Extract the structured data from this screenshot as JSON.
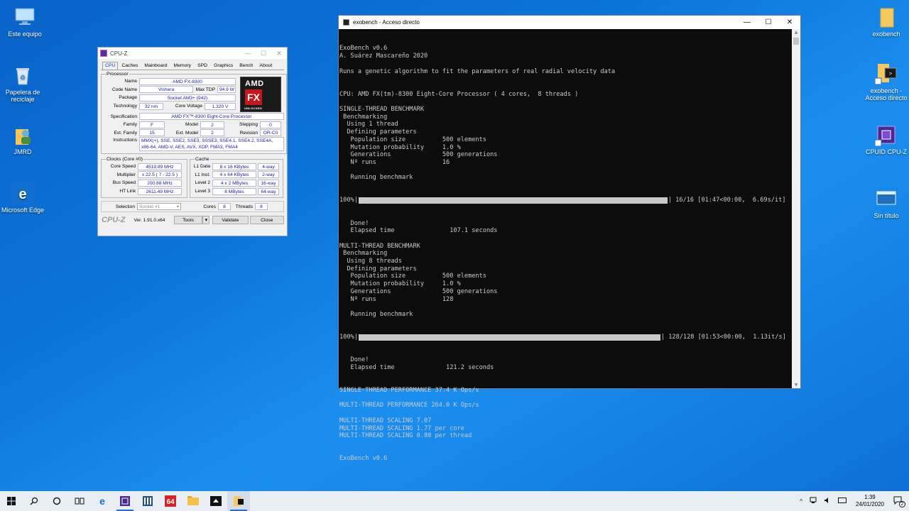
{
  "desktop": {
    "icons_left": [
      {
        "label": "Este equipo",
        "icon": "computer-icon"
      },
      {
        "label": "Papelera de reciclaje",
        "icon": "recycle-bin-icon"
      },
      {
        "label": "JMRD",
        "icon": "user-folder-icon"
      },
      {
        "label": "Microsoft Edge",
        "icon": "edge-icon"
      }
    ],
    "icons_right": [
      {
        "label": "exobench",
        "icon": "folder-icon"
      },
      {
        "label": "exobench - Acceso directo",
        "icon": "shortcut-icon"
      },
      {
        "label": "CPUID CPU-Z",
        "icon": "cpuz-icon"
      },
      {
        "label": "Sin título",
        "icon": "window-icon"
      }
    ]
  },
  "cpuz": {
    "title": "CPU-Z",
    "tabs": [
      "CPU",
      "Caches",
      "Mainboard",
      "Memory",
      "SPD",
      "Graphics",
      "Bench",
      "About"
    ],
    "processor_legend": "Processor",
    "name_label": "Name",
    "name": "AMD FX-8300",
    "codename_label": "Code Name",
    "codename": "Vishera",
    "maxtdp_label": "Max TDP",
    "maxtdp": "94.9 W",
    "package_label": "Package",
    "package": "Socket AM3+ (942)",
    "technology_label": "Technology",
    "technology": "32 nm",
    "corevoltage_label": "Core Voltage",
    "corevoltage": "1.320 V",
    "spec_label": "Specification",
    "spec": "AMD FX™-8300 Eight-Core Processor",
    "family_label": "Family",
    "family": "F",
    "model_label": "Model",
    "model": "2",
    "stepping_label": "Stepping",
    "stepping": "0",
    "extfamily_label": "Ext. Family",
    "extfamily": "15",
    "extmodel_label": "Ext. Model",
    "extmodel": "2",
    "revision_label": "Revision",
    "revision": "OR-C0",
    "instructions_label": "Instructions",
    "instructions_line1": "MMX(+), SSE, SSE2, SSE3, SSSE3, SSE4.1, SSE4.2, SSE4A,",
    "instructions_line2": "x86-64, AMD-V, AES, AVX, XOP, FMA3, FMA4",
    "logo_brand": "AMD",
    "logo_fx": "FX",
    "logo_sub": "UNLOCKED",
    "clocks_legend": "Clocks (Core #0)",
    "corespeed_label": "Core Speed",
    "corespeed": "4519.89 MHz",
    "multiplier_label": "Multiplier",
    "multiplier": "x 22.5 ( 7 - 22.5 )",
    "busspeed_label": "Bus Speed",
    "busspeed": "200.88 MHz",
    "htlink_label": "HT Link",
    "htlink": "2611.49 MHz",
    "cache_legend": "Cache",
    "l1data_label": "L1 Data",
    "l1data": "8 x 16 KBytes",
    "l1data_way": "4-way",
    "l1inst_label": "L1 Inst.",
    "l1inst": "4 x 64 KBytes",
    "l1inst_way": "2-way",
    "level2_label": "Level 2",
    "level2": "4 x 2 MBytes",
    "level2_way": "16-way",
    "level3_label": "Level 3",
    "level3": "8 MBytes",
    "level3_way": "64-way",
    "selection_label": "Selection",
    "selection": "Socket #1",
    "cores_label": "Cores",
    "cores": "8",
    "threads_label": "Threads",
    "threads": "8",
    "brand": "CPU-Z",
    "version": "Ver. 1.91.0.x64",
    "tools_label": "Tools",
    "validate_label": "Validate",
    "close_label": "Close"
  },
  "console": {
    "title": "exobench - Acceso directo",
    "lines_top": [
      "ExoBench v0.6",
      "A. Suárez Mascareño 2020",
      "",
      "Runs a genetic algorithm to fit the parameters of real radial velocity data",
      "",
      "",
      "CPU: AMD FX(tm)-8300 Eight-Core Processor ( 4 cores,  8 threads )",
      "",
      "SINGLE-THREAD BENCHMARK",
      " Benchmarking",
      "  Using 1 thread",
      "  Defining parameters",
      "   Population size          500 elements",
      "   Mutation probability     1.0 %",
      "   Generations              500 generations",
      "   Nº runs                  16",
      "",
      "   Running benchmark"
    ],
    "progress1": {
      "prefix": "100%|",
      "fraction": 1.0,
      "suffix": "| 16/16 [01:47<00:00,  6.69s/it]"
    },
    "lines_mid": [
      "   Done!",
      "   Elapsed time               107.1 seconds",
      "",
      "MULTI-THREAD BENCHMARK",
      " Benchmarking",
      "  Using 8 threads",
      "  Defining parameters",
      "   Population size          500 elements",
      "   Mutation probability     1.0 %",
      "   Generations              500 generations",
      "   Nº runs                  128",
      "",
      "   Running benchmark"
    ],
    "progress2": {
      "prefix": "100%|",
      "fraction": 1.0,
      "suffix": "| 128/128 [01:53<00:00,  1.13it/s]"
    },
    "lines_bottom": [
      "   Done!",
      "   Elapsed time              121.2 seconds",
      "",
      "",
      "SINGLE-THREAD PERFORMANCE 37.4 K Ops/s",
      "",
      "MULTI-THREAD PERFORMANCE 264.0 K Ops/s",
      "",
      "MULTI-THREAD SCALING 7.07",
      "MULTI-THREAD SCALING 1.77 per core",
      "MULTI-THREAD SCALING 0.88 per thread",
      "",
      "",
      "ExoBench v0.6"
    ]
  },
  "taskbar": {
    "clock_time": "1:39",
    "clock_date": "24/01/2020",
    "notification_count": "2"
  }
}
